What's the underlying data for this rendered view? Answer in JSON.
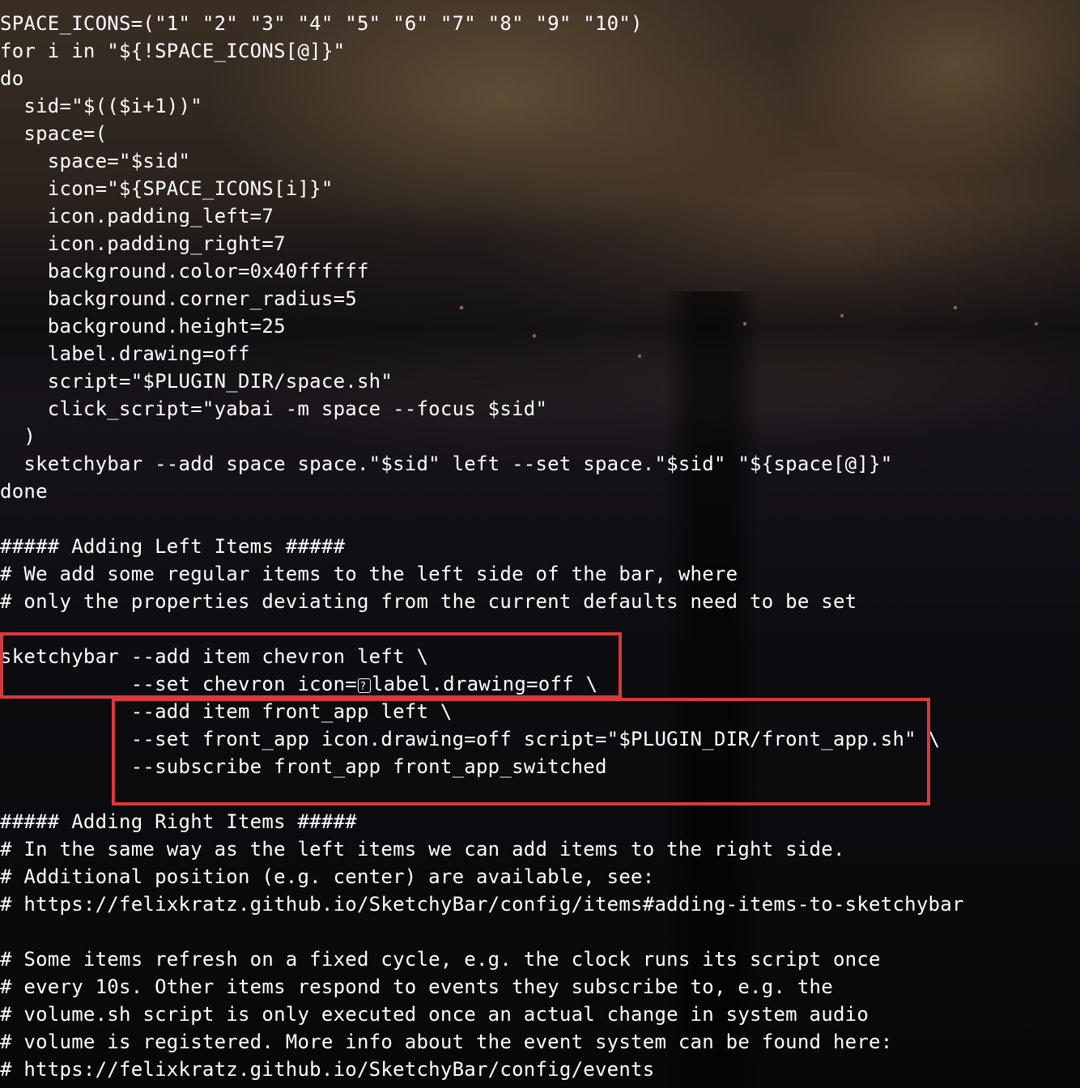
{
  "background": {
    "description_icon": "night-city-skyline-wallpaper",
    "colors": {
      "text": "#ffffff",
      "highlight": "#d8393c"
    }
  },
  "code_lines": [
    "SPACE_ICONS=(\"1\" \"2\" \"3\" \"4\" \"5\" \"6\" \"7\" \"8\" \"9\" \"10\")",
    "for i in \"${!SPACE_ICONS[@]}\"",
    "do",
    "  sid=\"$(($i+1))\"",
    "  space=(",
    "    space=\"$sid\"",
    "    icon=\"${SPACE_ICONS[i]}\"",
    "    icon.padding_left=7",
    "    icon.padding_right=7",
    "    background.color=0x40ffffff",
    "    background.corner_radius=5",
    "    background.height=25",
    "    label.drawing=off",
    "    script=\"$PLUGIN_DIR/space.sh\"",
    "    click_script=\"yabai -m space --focus $sid\"",
    "  )",
    "  sketchybar --add space space.\"$sid\" left --set space.\"$sid\" \"${space[@]}\"",
    "done",
    "",
    "##### Adding Left Items #####",
    "# We add some regular items to the left side of the bar, where",
    "# only the properties deviating from the current defaults need to be set",
    "",
    "sketchybar --add item chevron left \\",
    "           --set chevron icon=",
    "           --add item front_app left \\",
    "           --set front_app icon.drawing=off script=\"$PLUGIN_DIR/front_app.sh\" \\",
    "           --subscribe front_app front_app_switched",
    "",
    "##### Adding Right Items #####",
    "# In the same way as the left items we can add items to the right side.",
    "# Additional position (e.g. center) are available, see:",
    "# https://felixkratz.github.io/SketchyBar/config/items#adding-items-to-sketchybar",
    "",
    "# Some items refresh on a fixed cycle, e.g. the clock runs its script once",
    "# every 10s. Other items respond to events they subscribe to, e.g. the",
    "# volume.sh script is only executed once an actual change in system audio",
    "# volume is registered. More info about the event system can be found here:",
    "# https://felixkratz.github.io/SketchyBar/config/events"
  ],
  "chevron_line_tail": "label.drawing=off \\",
  "chevron_icon": "missing-glyph-icon"
}
